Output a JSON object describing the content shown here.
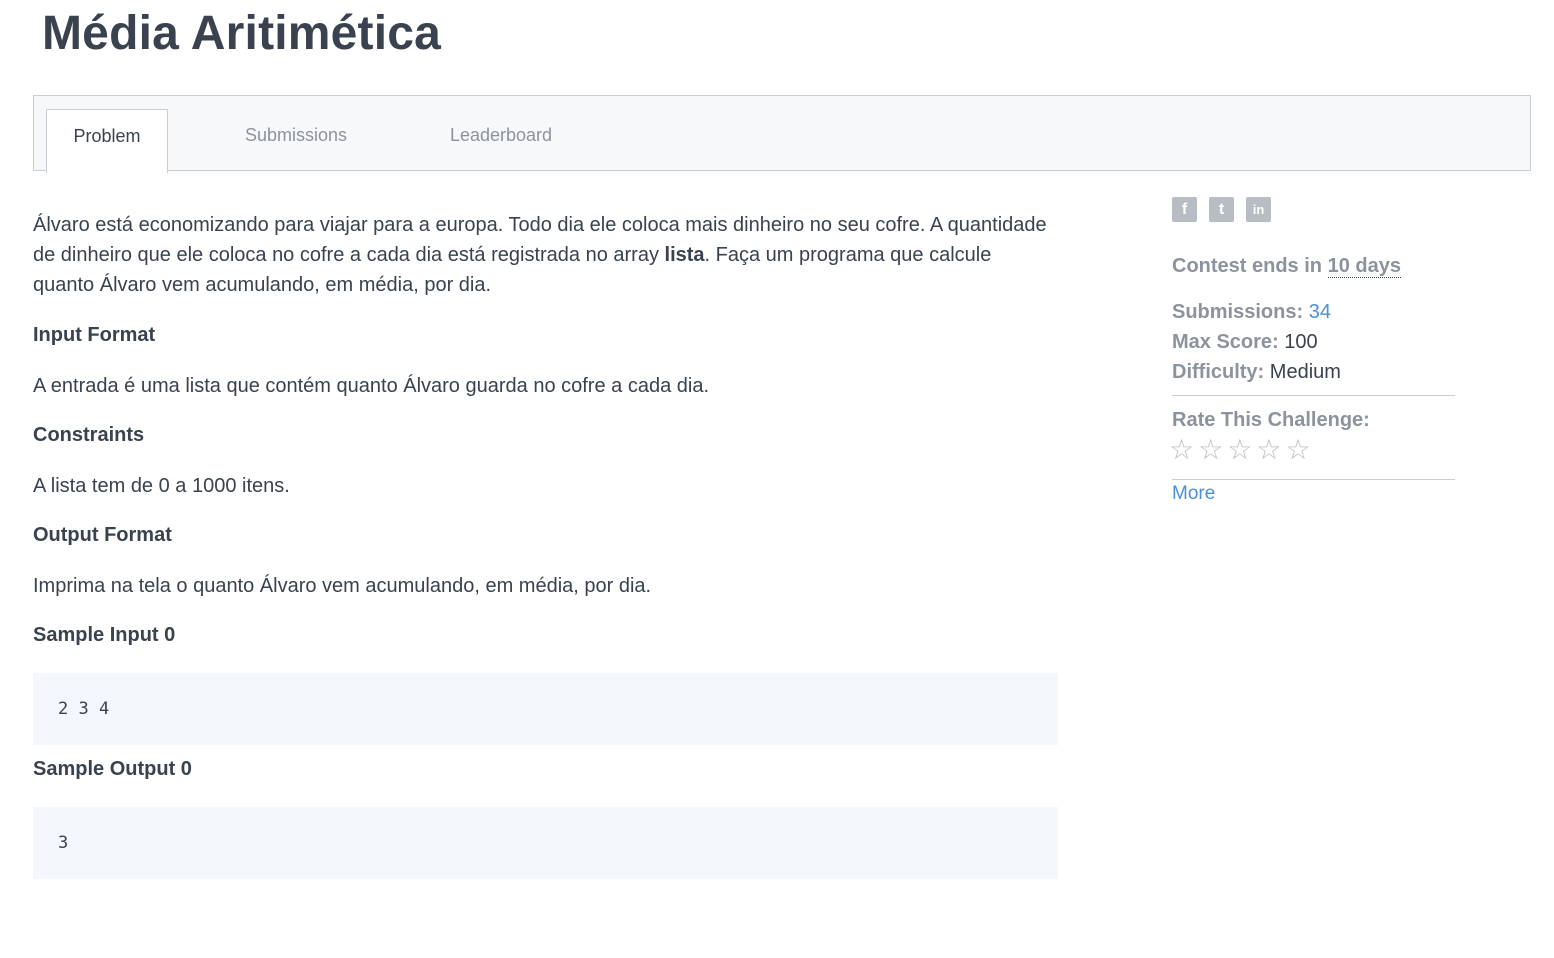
{
  "page": {
    "title": "Média Aritimética"
  },
  "tabs": [
    {
      "label": "Problem"
    },
    {
      "label": "Submissions"
    },
    {
      "label": "Leaderboard"
    }
  ],
  "problem": {
    "intro_part1": "Álvaro está economizando para viajar para a europa. Todo dia ele coloca mais dinheiro no seu cofre. A quantidade de dinheiro que ele coloca no cofre a cada dia está registrada no array ",
    "intro_bold": "lista",
    "intro_part2": ". Faça um programa que calcule quanto Álvaro vem acumulando, em média, por dia.",
    "input_format_heading": "Input Format",
    "input_format_text": "A entrada é uma lista que contém quanto Álvaro guarda no cofre a cada dia.",
    "constraints_heading": "Constraints",
    "constraints_text": "A lista tem de 0 a 1000 itens.",
    "output_format_heading": "Output Format",
    "output_format_text": "Imprima na tela o quanto Álvaro vem acumulando, em média, por dia.",
    "sample_input_heading": "Sample Input 0",
    "sample_input_value": "2 3 4",
    "sample_output_heading": "Sample Output 0",
    "sample_output_value": "3"
  },
  "sidebar": {
    "social": [
      {
        "icon": "facebook-icon",
        "glyph": "f"
      },
      {
        "icon": "twitter-icon",
        "glyph": "t"
      },
      {
        "icon": "linkedin-icon",
        "glyph": "in"
      }
    ],
    "contest_ends_prefix": "Contest ends in ",
    "contest_ends_value": "10 days",
    "submissions_label": "Submissions:",
    "submissions_value": "34",
    "max_score_label": "Max Score:",
    "max_score_value": "100",
    "difficulty_label": "Difficulty:",
    "difficulty_value": "Medium",
    "rate_label": "Rate This Challenge:",
    "rating": {
      "value": 0,
      "max": 5,
      "star_glyph": "☆"
    },
    "more_label": "More"
  }
}
